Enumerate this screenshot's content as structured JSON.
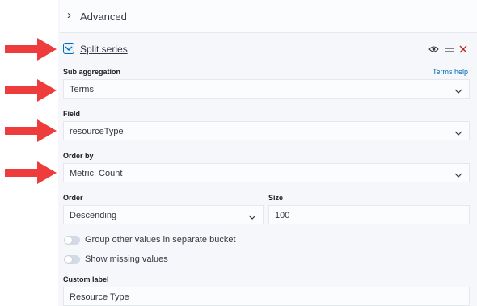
{
  "advanced": {
    "label": "Advanced"
  },
  "split_series": {
    "title": "Split series"
  },
  "sub_aggregation": {
    "label": "Sub aggregation",
    "help": "Terms help",
    "value": "Terms"
  },
  "field": {
    "label": "Field",
    "value": "resourceType"
  },
  "order_by": {
    "label": "Order by",
    "value": "Metric: Count"
  },
  "order": {
    "label": "Order",
    "value": "Descending"
  },
  "size": {
    "label": "Size",
    "value": "100"
  },
  "toggles": {
    "group_other": {
      "label": "Group other values in separate bucket",
      "on": false
    },
    "show_missing": {
      "label": "Show missing values",
      "on": false
    }
  },
  "custom_label": {
    "label": "Custom label",
    "value": "Resource Type"
  },
  "icons": {
    "eye": "eye-icon",
    "drag": "drag-handle-icon",
    "remove": "close-icon",
    "annotation": "red-arrow-icon"
  },
  "colors": {
    "accent": "#006bb8",
    "danger": "#bd271e",
    "arrow": "#ee3b3b"
  }
}
